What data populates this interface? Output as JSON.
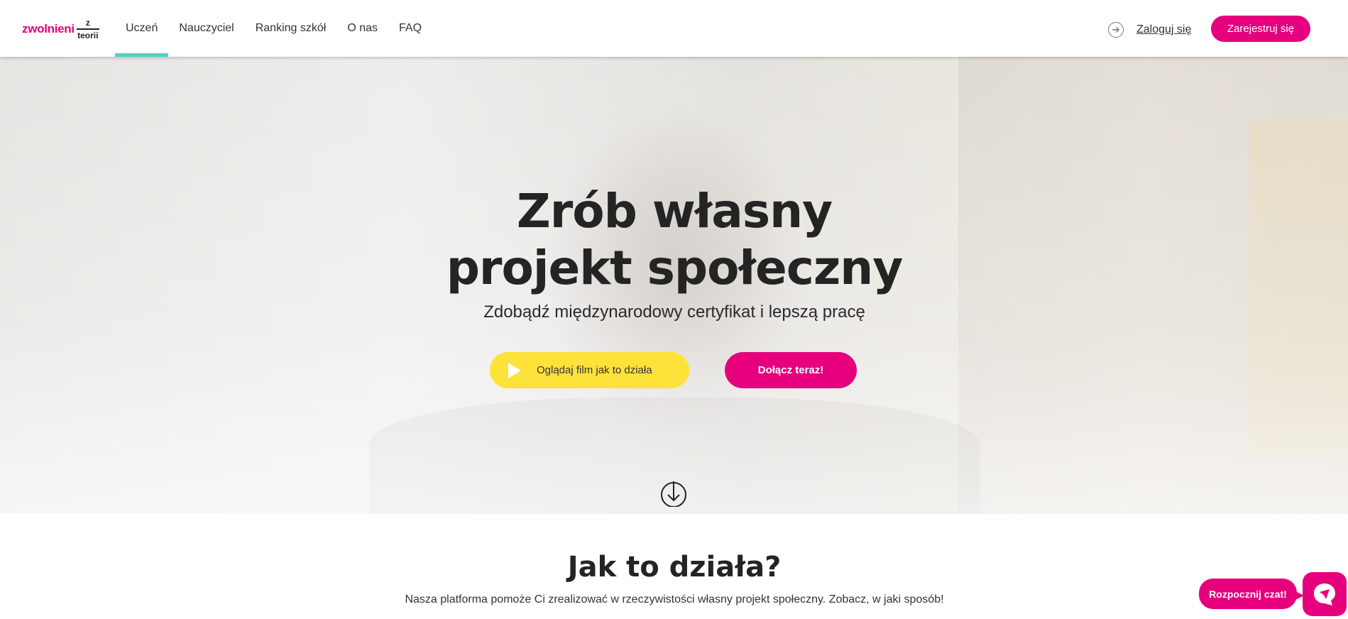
{
  "logo": {
    "main": "zwolnieni",
    "top": "z",
    "bottom": "teorii"
  },
  "nav": {
    "items": [
      {
        "label": "Uczeń",
        "active": true
      },
      {
        "label": "Nauczyciel"
      },
      {
        "label": "Ranking szkół"
      },
      {
        "label": "O nas"
      },
      {
        "label": "FAQ"
      }
    ]
  },
  "header": {
    "login_label": "Zaloguj się",
    "register_label": "Zarejestruj się"
  },
  "hero": {
    "title_line1": "Zrób własny",
    "title_line2": "projekt społeczny",
    "subtitle": "Zdobądź międzynarodowy certyfikat i lepszą pracę",
    "watch_label": "Oglądaj film jak to działa",
    "join_label": "Dołącz teraz!"
  },
  "how": {
    "title": "Jak to działa?",
    "description": "Nasza platforma pomoże Ci zrealizować w rzeczywistości własny projekt społeczny. Zobacz, w jaki sposób!"
  },
  "chat": {
    "label": "Rozpocznij czat!"
  },
  "colors": {
    "brand": "#e6007e",
    "accent": "#4fd1c5",
    "yellow": "#fde23a"
  }
}
